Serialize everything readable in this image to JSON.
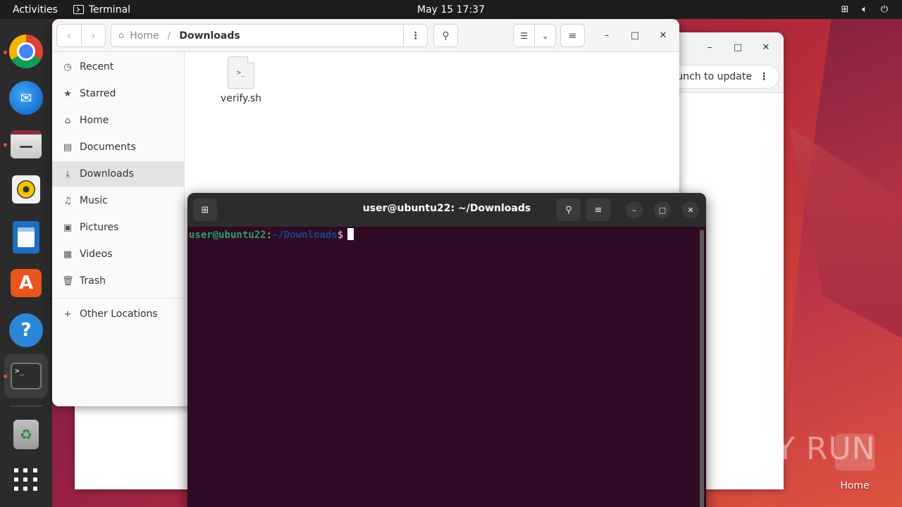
{
  "topbar": {
    "activities": "Activities",
    "app_name": "Terminal",
    "clock": "May 15  17:37",
    "tray_icons": [
      "network-icon",
      "volume-icon",
      "power-icon"
    ]
  },
  "dock": {
    "apps": [
      "Google Chrome",
      "Thunderbird",
      "Files",
      "Rhythmbox",
      "LibreOffice Writer",
      "Ubuntu Software",
      "Help",
      "Terminal",
      "Trash",
      "Show Applications"
    ]
  },
  "back_window": {
    "pill_text": "launch to update"
  },
  "files": {
    "breadcrumb_home": "Home",
    "breadcrumb_current": "Downloads",
    "sidebar": [
      {
        "label": "Recent",
        "icon": "clock-icon"
      },
      {
        "label": "Starred",
        "icon": "star-icon"
      },
      {
        "label": "Home",
        "icon": "home-icon"
      },
      {
        "label": "Documents",
        "icon": "document-icon"
      },
      {
        "label": "Downloads",
        "icon": "download-icon"
      },
      {
        "label": "Music",
        "icon": "music-icon"
      },
      {
        "label": "Pictures",
        "icon": "picture-icon"
      },
      {
        "label": "Videos",
        "icon": "video-icon"
      },
      {
        "label": "Trash",
        "icon": "trash-icon"
      }
    ],
    "other_locations": "Other Locations",
    "items": [
      {
        "name": "verify.sh",
        "icon_text": ">_"
      }
    ]
  },
  "terminal": {
    "title": "user@ubuntu22: ~/Downloads",
    "prompt_user": "user@ubuntu22",
    "prompt_colon": ":",
    "prompt_path": "~/Downloads",
    "prompt_symbol": "$"
  },
  "desktop": {
    "home_label": "Home",
    "watermark": "ANY RUN"
  },
  "colors": {
    "accent": "#e95420",
    "terminal_bg": "#300a24",
    "prompt_user": "#26a269",
    "prompt_path": "#12488b"
  }
}
